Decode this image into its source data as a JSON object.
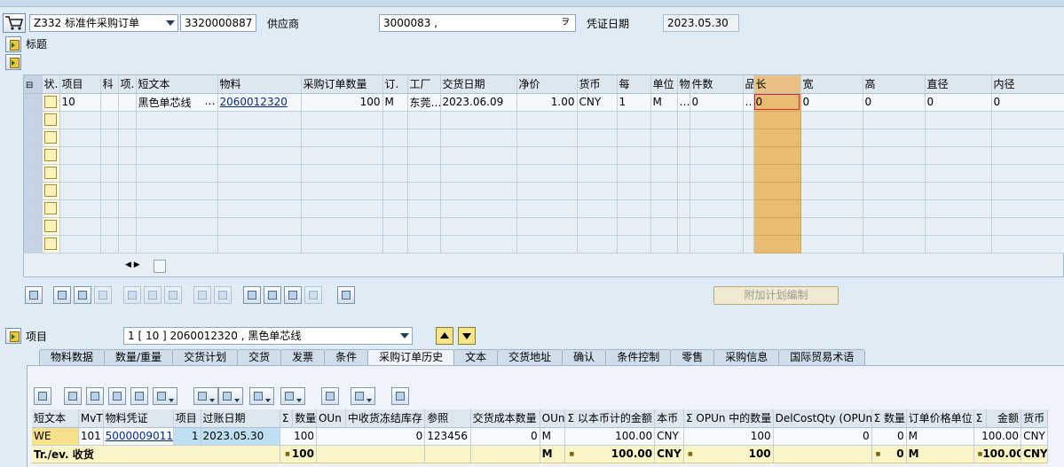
{
  "header": {
    "doc_type": "Z332 标准件采购订单",
    "po_number": "3320000887",
    "vendor_label": "供应商",
    "vendor_value": "3000083 ,",
    "doc_date_label": "凭证日期",
    "doc_date_value": "2023.05.30",
    "title_section": "标题"
  },
  "items_table": {
    "columns": [
      "",
      "状.",
      "项目",
      "科",
      "项.",
      "短文本",
      "物料",
      "采购订单数量",
      "订.",
      "工厂",
      "交货日期",
      "净价",
      "货币",
      "每",
      "单位",
      "物",
      "件数",
      "品",
      "长",
      "宽",
      "高",
      "直径",
      "内径"
    ],
    "row": {
      "item": "10",
      "short_text": "黑色单芯线",
      "ellipsis": "…",
      "material": "2060012320",
      "qty": "100",
      "uom": "M",
      "plant": "东莞…",
      "delivery_date": "2023.06.09",
      "net_price": "1.00",
      "currency": "CNY",
      "per": "1",
      "unit": "M",
      "mat_dots": "…",
      "pieces": "0",
      "prod_dots": "…",
      "length": "0",
      "width": "0",
      "height": "0",
      "diameter": "0",
      "inner_diameter": "0"
    },
    "empty_rows": 8
  },
  "plan_button": "附加计划编制",
  "item_section": {
    "label": "项目",
    "selector_value": "1 [ 10 ] 2060012320 , 黑色单芯线"
  },
  "tabs": [
    "物料数据",
    "数量/重量",
    "交货计划",
    "交货",
    "发票",
    "条件",
    "采购订单历史",
    "文本",
    "交货地址",
    "确认",
    "条件控制",
    "零售",
    "采购信息",
    "国际贸易术语"
  ],
  "active_tab": "采购订单历史",
  "history_table": {
    "columns": [
      "短文本",
      "MvT",
      "物料凭证",
      "项目",
      "过账日期",
      "Σ",
      "数量",
      "OUn",
      "中收货冻结库存",
      "参照",
      "交货成本数量",
      "OUn",
      "Σ 以本币计的金额",
      "本币",
      "Σ OPUn 中的数量",
      "DelCostQty (OPUn)",
      "Σ 数量",
      "订单价格单位",
      "Σ",
      "金额",
      "货币"
    ],
    "row": {
      "short_text": "WE",
      "mvt": "101",
      "mat_doc": "5000009011",
      "item": "1",
      "posting_date": "2023.05.30",
      "qty": "100",
      "blocked": "0",
      "reference": "123456",
      "del_cost_qty": "0",
      "oun": "M",
      "amount_lc": "100.00",
      "local_currency": "CNY",
      "qty_opun": "100",
      "del_cost_opun": "0",
      "qty2": "0",
      "order_price_unit": "M",
      "amount": "100.00",
      "currency": "CNY"
    },
    "total_row": {
      "label": "Tr./ev. 收货",
      "qty": "100",
      "oun": "M",
      "amount_lc": "100.00",
      "local_currency": "CNY",
      "qty_opun": "100",
      "qty2": "0",
      "order_price_unit": "M",
      "amount": "100.00",
      "currency": "CNY"
    }
  }
}
